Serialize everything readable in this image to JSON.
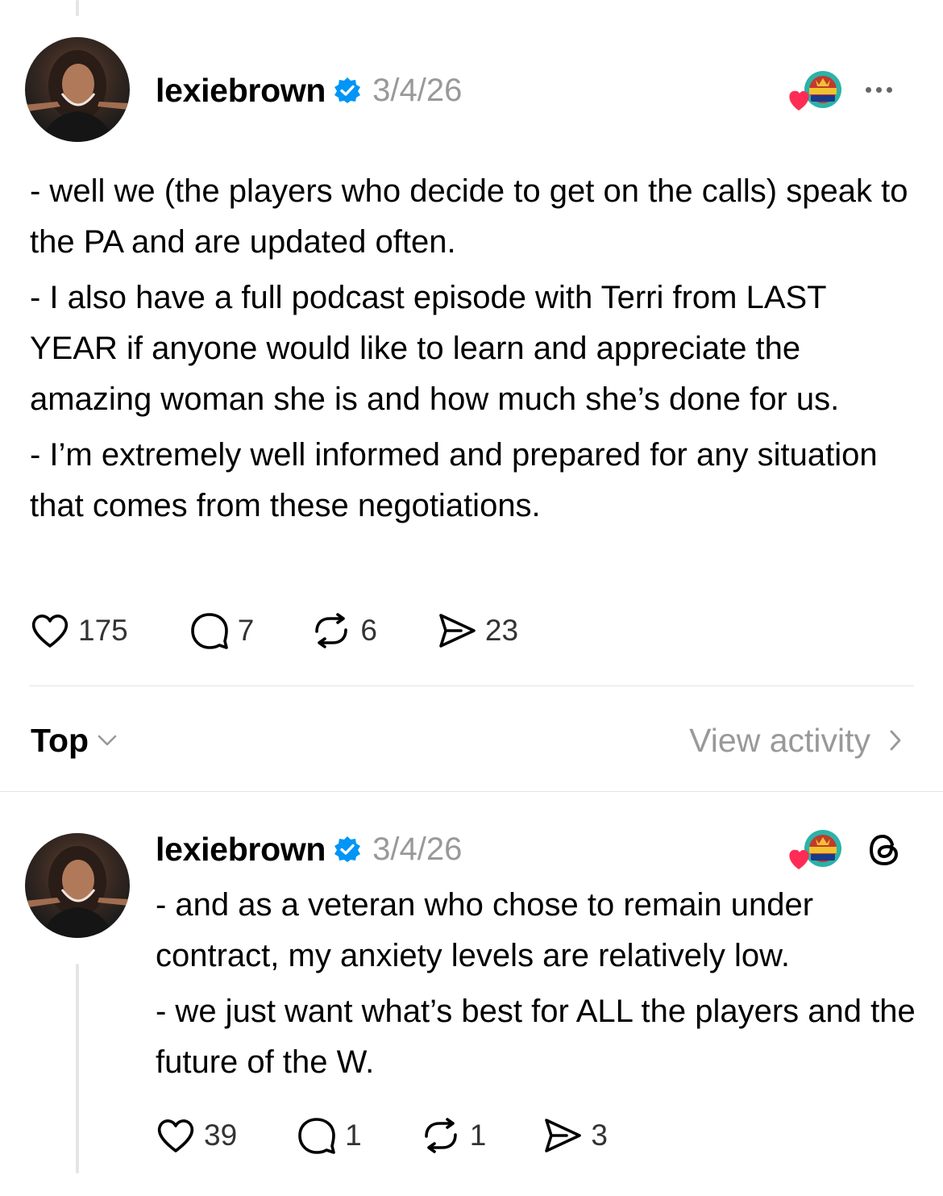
{
  "post": {
    "username": "lexiebrown",
    "date": "3/4/26",
    "paragraphs": [
      "- well we (the players who decide to get on the calls) speak to the PA and are updated often.",
      "- I also have a full podcast episode with Terri from LAST YEAR if anyone would like to learn and appreciate the amazing woman she is and how much she’s done for us.",
      "- I’m extremely well informed and prepared for any situation that comes from these negotiations."
    ],
    "likes": "175",
    "replies": "7",
    "reposts": "6",
    "shares": "23"
  },
  "sort": {
    "label": "Top",
    "view_activity_label": "View activity"
  },
  "reply": {
    "username": "lexiebrown",
    "date": "3/4/26",
    "paragraphs": [
      "- and as a veteran who chose to remain under contract, my anxiety levels are relatively low.",
      "- we just want what’s best for ALL the players and the future of the W."
    ],
    "likes": "39",
    "replies": "1",
    "reposts": "1",
    "shares": "3"
  },
  "icons": {
    "verified": "verified-badge-icon",
    "like": "heart-icon",
    "reply": "comment-icon",
    "repost": "repost-icon",
    "share": "send-icon",
    "more": "more-dots-icon",
    "threads": "threads-logo-icon",
    "chevron_down": "chevron-down-icon",
    "chevron_right": "chevron-right-icon"
  },
  "colors": {
    "verified_blue": "#0095f6",
    "reaction_heart": "#ff2d55",
    "muted_text": "#999999"
  }
}
